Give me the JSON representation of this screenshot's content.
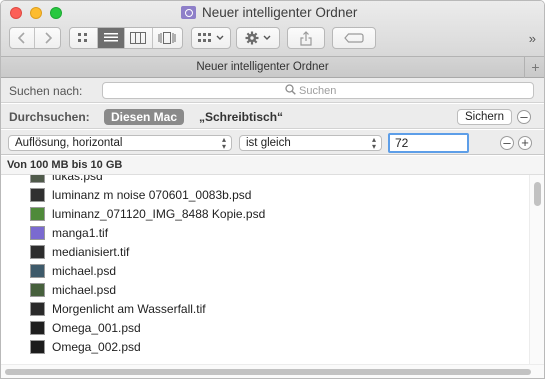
{
  "window": {
    "title": "Neuer intelligenter Ordner",
    "tab_title": "Neuer intelligenter Ordner",
    "tab_add": "+"
  },
  "toolbar": {
    "back_icon": "chevron-left-icon",
    "forward_icon": "chevron-right-icon",
    "view_modes": [
      "icon-view-icon",
      "list-view-icon",
      "column-view-icon",
      "coverflow-view-icon"
    ],
    "active_view": "list-view-icon",
    "more": "»"
  },
  "search": {
    "label": "Suchen nach:",
    "placeholder": "Suchen"
  },
  "scope": {
    "label": "Durchsuchen:",
    "this_mac": "Diesen Mac",
    "desktop": "„Schreibtisch“",
    "save_label": "Sichern"
  },
  "criteria": {
    "attribute": "Auflösung, horizontal",
    "operator": "ist gleich",
    "value": "72"
  },
  "group": {
    "header": "Von 100 MB bis 10 GB"
  },
  "files": [
    {
      "name": "lukas.psd",
      "color": "#4f5a4a"
    },
    {
      "name": "luminanz m noise 070601_0083b.psd",
      "color": "#303030"
    },
    {
      "name": "luminanz_071120_IMG_8488 Kopie.psd",
      "color": "#4f8a3a"
    },
    {
      "name": "manga1.tif",
      "color": "#7a6ad0"
    },
    {
      "name": "medianisiert.tif",
      "color": "#2d2d2d"
    },
    {
      "name": "michael.psd",
      "color": "#3e5a6a"
    },
    {
      "name": "michael.psd",
      "color": "#47603d"
    },
    {
      "name": "Morgenlicht am Wasserfall.tif",
      "color": "#2a2a2a"
    },
    {
      "name": "Omega_001.psd",
      "color": "#1f1f1f"
    },
    {
      "name": "Omega_002.psd",
      "color": "#1c1c1c"
    }
  ],
  "colors": {
    "focus_ring": "#5d9ee8",
    "scope_active": "#8a8a8a"
  }
}
